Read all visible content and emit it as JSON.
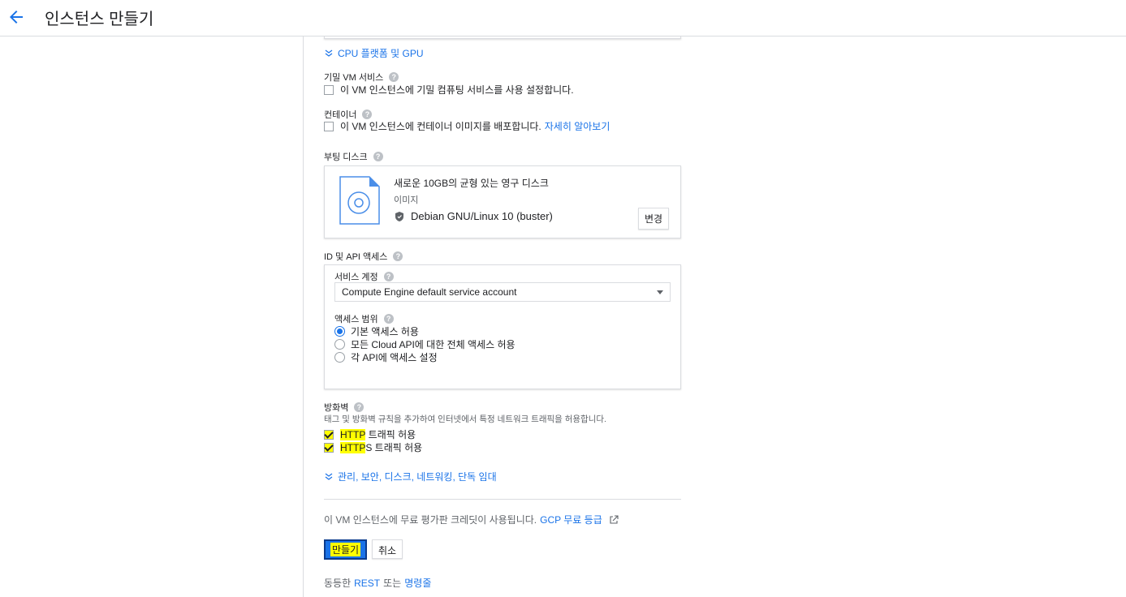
{
  "header": {
    "title": "인스턴스 만들기"
  },
  "cpu_expander": "CPU 플랫폼 및 GPU",
  "confidential": {
    "label": "기밀 VM 서비스",
    "checkbox": "이 VM 인스턴스에 기밀 컴퓨팅 서비스를 사용 설정합니다."
  },
  "container": {
    "label": "컨테이너",
    "checkbox": "이 VM 인스턴스에 컨테이너 이미지를 배포합니다.",
    "learn_more": "자세히 알아보기"
  },
  "boot_disk": {
    "label": "부팅 디스크",
    "title": "새로운 10GB의 균형 있는 영구 디스크",
    "image_label": "이미지",
    "image": "Debian GNU/Linux 10 (buster)",
    "change_button": "변경"
  },
  "identity": {
    "label": "ID 및 API 액세스",
    "service_account_label": "서비스 계정",
    "service_account_value": "Compute Engine default service account",
    "scope_label": "액세스 범위",
    "scopes": [
      {
        "label": "기본 액세스 허용",
        "selected": true
      },
      {
        "label": "모든 Cloud API에 대한 전체 액세스 허용",
        "selected": false
      },
      {
        "label": "각 API에 액세스 설정",
        "selected": false
      }
    ]
  },
  "firewall": {
    "label": "방화벽",
    "description": "태그 및 방화벽 규칙을 추가하여 인터넷에서 특정 네트워크 트래픽을 허용합니다.",
    "http_prefix": "HTTP",
    "http_suffix": " 트래픽 허용",
    "https_prefix": "HTTP",
    "https_suffix": "S 트래픽 허용"
  },
  "advanced_expander": "관리, 보안, 디스크, 네트워킹, 단독 임대",
  "free_trial": {
    "text": "이 VM 인스턴스에 무료 평가판 크레딧이 사용됩니다.",
    "link": "GCP 무료 등급"
  },
  "actions": {
    "create": "만들기",
    "cancel": "취소"
  },
  "footer": {
    "prefix": "동등한",
    "rest": "REST",
    "middle": "또는",
    "cmdline": "명령줄"
  }
}
